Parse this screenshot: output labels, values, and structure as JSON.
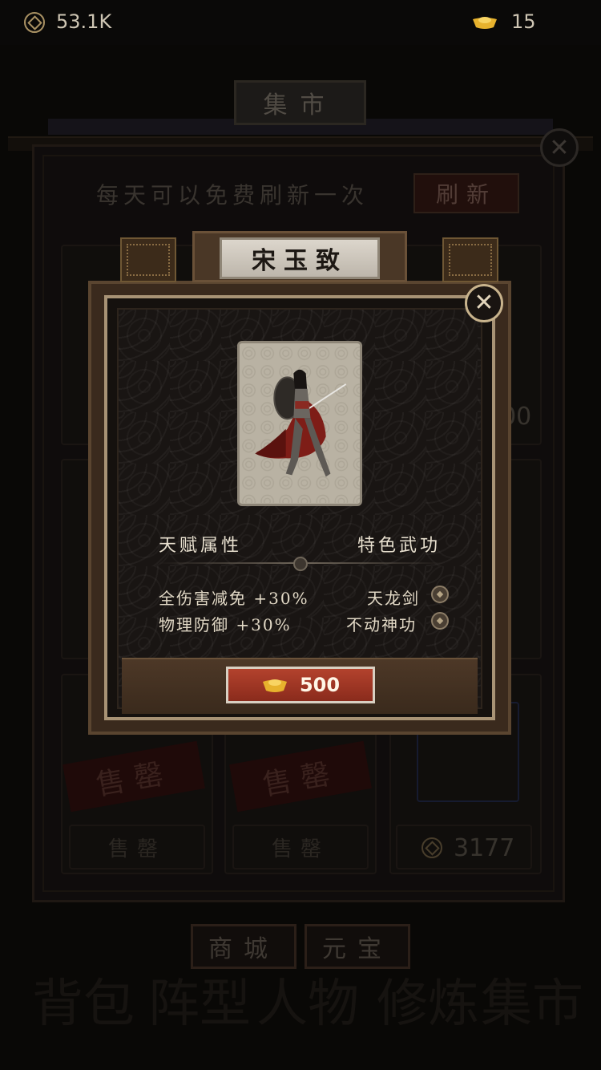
{
  "currency": {
    "coins": "53.1K",
    "ingots": "15"
  },
  "background": {
    "title": "集市",
    "hint": "每天可以免费刷新一次",
    "refresh_label": "刷新",
    "sold_label": "售罄",
    "sold_button_label": "售罄",
    "price_right_partial": "000",
    "price_bottom_right": "3177",
    "tabs": [
      "商城",
      "元宝"
    ],
    "bottom_nav": [
      "背包",
      "阵型",
      "人物",
      "修炼",
      "集市"
    ]
  },
  "modal": {
    "name": "宋玉致",
    "talent_title": "天赋属性",
    "skill_title": "特色武功",
    "talents": [
      "全伤害减免 +30%",
      "物理防御 +30%"
    ],
    "skills": [
      "天龙剑",
      "不动神功"
    ],
    "price": "500",
    "close_symbol": "✕"
  },
  "icons": {
    "coin": "coin-icon",
    "ingot": "gold-ingot-icon",
    "close": "close-icon",
    "skill": "skill-badge-icon"
  },
  "colors": {
    "accent_red": "#a4392a",
    "gold": "#e8b430",
    "frame": "#a89375"
  }
}
